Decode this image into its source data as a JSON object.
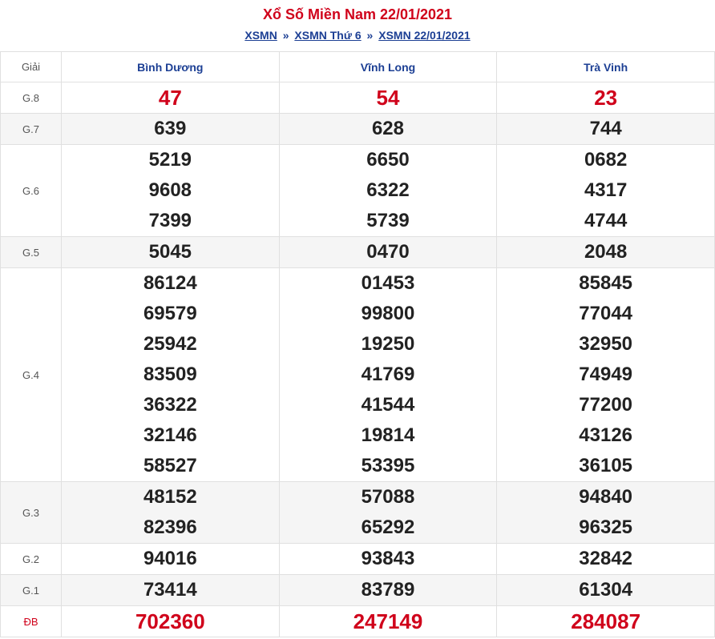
{
  "header": {
    "title": "Xổ Số Miền Nam 22/01/2021",
    "breadcrumb": [
      {
        "label": "XSMN"
      },
      {
        "label": "XSMN Thứ 6"
      },
      {
        "label": "XSMN 22/01/2021"
      }
    ],
    "separator": "»"
  },
  "table": {
    "label_header": "Giải",
    "provinces": [
      "Bình Dương",
      "Vĩnh Long",
      "Trà Vinh"
    ],
    "rows": [
      {
        "label": "G.8",
        "values": [
          [
            "47"
          ],
          [
            "54"
          ],
          [
            "23"
          ]
        ]
      },
      {
        "label": "G.7",
        "values": [
          [
            "639"
          ],
          [
            "628"
          ],
          [
            "744"
          ]
        ]
      },
      {
        "label": "G.6",
        "values": [
          [
            "5219",
            "9608",
            "7399"
          ],
          [
            "6650",
            "6322",
            "5739"
          ],
          [
            "0682",
            "4317",
            "4744"
          ]
        ]
      },
      {
        "label": "G.5",
        "values": [
          [
            "5045"
          ],
          [
            "0470"
          ],
          [
            "2048"
          ]
        ]
      },
      {
        "label": "G.4",
        "values": [
          [
            "86124",
            "69579",
            "25942",
            "83509",
            "36322",
            "32146",
            "58527"
          ],
          [
            "01453",
            "99800",
            "19250",
            "41769",
            "41544",
            "19814",
            "53395"
          ],
          [
            "85845",
            "77044",
            "32950",
            "74949",
            "77200",
            "43126",
            "36105"
          ]
        ]
      },
      {
        "label": "G.3",
        "values": [
          [
            "48152",
            "82396"
          ],
          [
            "57088",
            "65292"
          ],
          [
            "94840",
            "96325"
          ]
        ]
      },
      {
        "label": "G.2",
        "values": [
          [
            "94016"
          ],
          [
            "93843"
          ],
          [
            "32842"
          ]
        ]
      },
      {
        "label": "G.1",
        "values": [
          [
            "73414"
          ],
          [
            "83789"
          ],
          [
            "61304"
          ]
        ]
      },
      {
        "label": "ĐB",
        "values": [
          [
            "702360"
          ],
          [
            "247149"
          ],
          [
            "284087"
          ]
        ]
      }
    ]
  },
  "colors": {
    "highlight_red": "#d0021b",
    "link_blue": "#1c3f94"
  }
}
